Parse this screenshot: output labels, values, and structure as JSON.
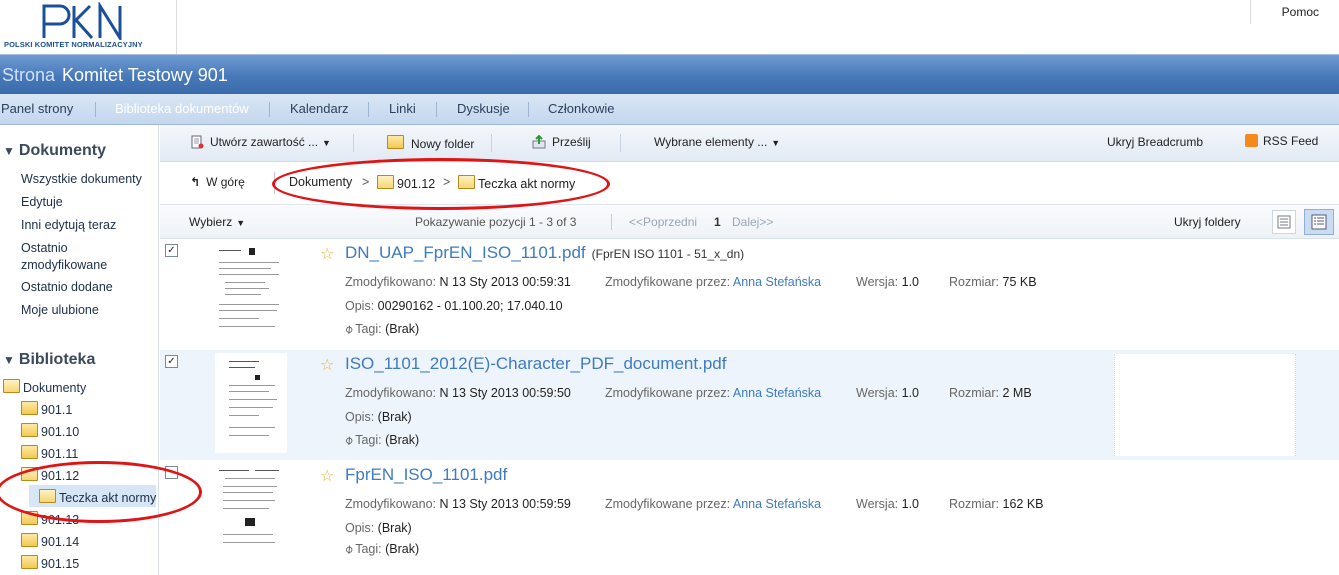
{
  "header": {
    "logo_text": "PKN",
    "org_name": "POLSKI KOMITET NORMALIZACYJNY",
    "help_label": "Pomoc"
  },
  "title": {
    "prefix": "Strona",
    "site_name": "Komitet Testowy 901"
  },
  "topnav": [
    {
      "label": "Panel strony"
    },
    {
      "label": "Biblioteka dokumentów"
    },
    {
      "label": "Kalendarz"
    },
    {
      "label": "Linki"
    },
    {
      "label": "Dyskusje"
    },
    {
      "label": "Członkowie"
    }
  ],
  "leftnav": {
    "documents_heading": "Dokumenty",
    "documents_links": [
      "Wszystkie dokumenty",
      "Edytuje",
      "Inni edytują teraz",
      "Ostatnio zmodyfikowane",
      "Ostatnio dodane",
      "Moje ulubione"
    ],
    "library_heading": "Biblioteka",
    "tree_root": "Dokumenty",
    "tree_items": [
      "901.1",
      "901.10",
      "901.11",
      "901.12",
      "Teczka akt normy",
      "901.13",
      "901.14",
      "901.15"
    ]
  },
  "toolbar": {
    "create_label": "Utwórz zawartość ...",
    "new_folder_label": "Nowy folder",
    "upload_label": "Prześlij",
    "selected_label": "Wybrane elementy ...",
    "hide_breadcrumb_label": "Ukryj Breadcrumb",
    "rss_label": "RSS Feed"
  },
  "breadcrumb": {
    "up_label": "W górę",
    "items": [
      "Dokumenty",
      "901.12",
      "Teczka akt normy"
    ],
    "separator": ">"
  },
  "list": {
    "select_label": "Wybierz",
    "paging_info": "Pokazywanie pozycji 1 - 3 of 3",
    "prev_label": "<<Poprzedni",
    "current_page": "1",
    "next_label": "Dalej>>",
    "hide_folders_label": "Ukryj foldery"
  },
  "labels": {
    "modified": "Zmodyfikowano:",
    "modified_by": "Zmodyfikowane przez:",
    "version": "Wersja:",
    "size": "Rozmiar:",
    "description": "Opis:",
    "tags": "Tagi:"
  },
  "documents": [
    {
      "title": "DN_UAP_FprEN_ISO_1101.pdf",
      "subtitle": "(FprEN ISO 1101 - 51_x_dn)",
      "modified": "N 13 Sty 2013 00:59:31",
      "modified_by": "Anna Stefańska",
      "version": "1.0",
      "size": "75 KB",
      "description": "00290162 - 01.100.20; 17.040.10",
      "tags": "(Brak)",
      "checked": true
    },
    {
      "title": "ISO_1101_2012(E)-Character_PDF_document.pdf",
      "subtitle": "",
      "modified": "N 13 Sty 2013 00:59:50",
      "modified_by": "Anna Stefańska",
      "version": "1.0",
      "size": "2 MB",
      "description": "(Brak)",
      "tags": "(Brak)",
      "checked": true
    },
    {
      "title": "FprEN_ISO_1101.pdf",
      "subtitle": "",
      "modified": "N 13 Sty 2013 00:59:59",
      "modified_by": "Anna Stefańska",
      "version": "1.0",
      "size": "162 KB",
      "description": "(Brak)",
      "tags": "(Brak)",
      "checked": false
    }
  ],
  "colors": {
    "title_bar": "#4778b8",
    "link": "#3e7bbf",
    "annotation": "#e01414"
  }
}
